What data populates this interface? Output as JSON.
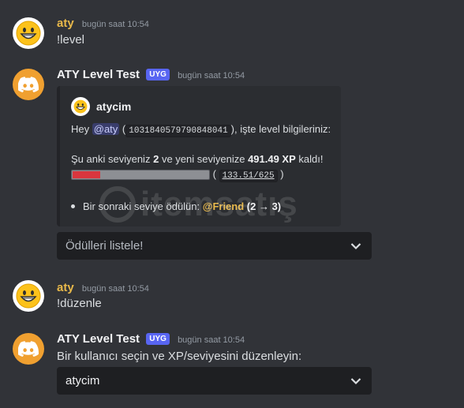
{
  "messages": [
    {
      "username": "aty",
      "timestamp": "bugün saat 10:54",
      "text": "!level"
    },
    {
      "username": "ATY Level Test",
      "badge": "UYG",
      "timestamp": "bugün saat 10:54"
    },
    {
      "username": "aty",
      "timestamp": "bugün saat 10:54",
      "text": "!düzenle"
    },
    {
      "username": "ATY Level Test",
      "badge": "UYG",
      "timestamp": "bugün saat 10:54",
      "text": "Bir kullanıcı seçin ve XP/seviyesini düzenleyin:"
    }
  ],
  "embed": {
    "author": "atycim",
    "greet_prefix": "Hey",
    "mention": "@aty",
    "user_id": "1031840579790848041",
    "greet_suffix": ", işte level bilgileriniz:",
    "level_prefix": "Şu anki seviyeniz",
    "level": "2",
    "level_mid": "ve yeni seviyenize",
    "xp_left": "491.49 XP",
    "level_suffix": "kaldı!",
    "progress_text": "133.51/625",
    "progress_fraction": 0.2136,
    "reward_label": "Bir sonraki seviye ödülün:",
    "reward_role": "@Friend",
    "reward_levels": "(2 → 3)"
  },
  "select1": {
    "placeholder": "Ödülleri listele!"
  },
  "select2": {
    "value": "atycim"
  },
  "watermark": {
    "text": "itemsatış"
  },
  "colors": {
    "background": "#313338",
    "embed_bg": "#2b2d31",
    "badge": "#5865f2",
    "username_user": "#e9b94a",
    "progress_fill": "#d9363e"
  },
  "icons": {
    "user_avatar": "grinning-face-icon",
    "bot_avatar": "discord-logo-icon",
    "select_arrow": "chevron-down-icon"
  }
}
